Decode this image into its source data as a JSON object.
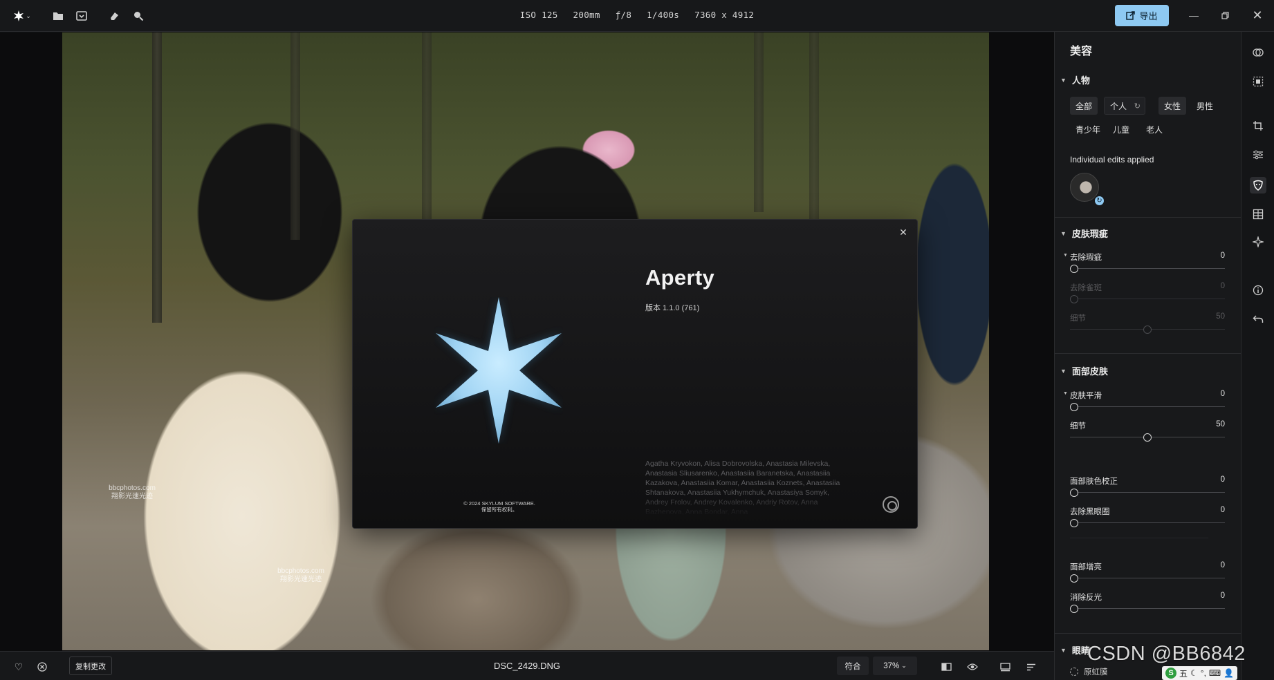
{
  "topbar": {
    "exif": [
      "ISO 125",
      "200mm",
      "ƒ/8",
      "1/400s",
      "7360 x 4912"
    ],
    "export_label": "导出",
    "icons": [
      "aperty-logo-icon",
      "chevron-down-icon",
      "folder-icon",
      "import-photo-icon",
      "eraser-icon",
      "search-icon",
      "export-icon",
      "minimize-icon",
      "restore-icon",
      "close-icon"
    ]
  },
  "photo": {
    "watermark_1": "bbcphotos.com\n翔影光速光迹",
    "watermark_2": "bbcphotos.com\n翔影光速光迹"
  },
  "dialog": {
    "title": "Aperty",
    "version": "版本 1.1.0 (761)",
    "credits": "Agatha Kryvokon, Alisa Dobrovolska, Anastasia Milevska, Anastasia Sliusarenko, Anastasiia Baranetska, Anastasiia Kazakova, Anastasiia Komar, Anastasiia Koznets, Anastasiia Shtanakova, Anastasiia Yukhymchuk, Anastasiya Somyk, Andrey Frolov, Andrey Kovalenko, Andriy Rotov, Anna Bazhenova, Anna Bondar, Anna",
    "copyright": "© 2024 SKYLUM SOFTWARE.\n保留所有权利。",
    "star_color": "#9fd3f3"
  },
  "bottombar": {
    "copy_changes": "复制更改",
    "filename": "DSC_2429.DNG",
    "fit_label": "符合",
    "zoom_label": "37%"
  },
  "panel": {
    "title": "美容",
    "people": {
      "header": "人物",
      "chips": [
        "全部",
        "个人",
        "女性",
        "男性",
        "青少年",
        "儿童",
        "老人"
      ],
      "selected": "全部",
      "individual_label": "Individual edits applied"
    },
    "skin_defects": {
      "header": "皮肤瑕疵",
      "sliders": [
        {
          "label": "去除瑕疵",
          "value": "0"
        },
        {
          "label": "去除雀斑",
          "value": "0"
        },
        {
          "label": "细节",
          "value": "50"
        }
      ]
    },
    "face_skin": {
      "header": "面部皮肤",
      "sliders": [
        {
          "label": "皮肤平滑",
          "value": "0"
        },
        {
          "label": "细节",
          "value": "50"
        },
        {
          "label": "面部肤色校正",
          "value": "0"
        },
        {
          "label": "去除黑眼圈",
          "value": "0"
        },
        {
          "label": "面部增亮",
          "value": "0"
        },
        {
          "label": "消除反光",
          "value": "0"
        }
      ]
    },
    "eyes": {
      "header": "眼睛",
      "first_item": "原虹膜"
    }
  },
  "overlay": {
    "csdn": "CSDN @BB6842",
    "ime": "五"
  },
  "colors": {
    "accent": "#8ec9f2",
    "panel_bg": "#18191b",
    "topbar_bg": "#17181a"
  }
}
